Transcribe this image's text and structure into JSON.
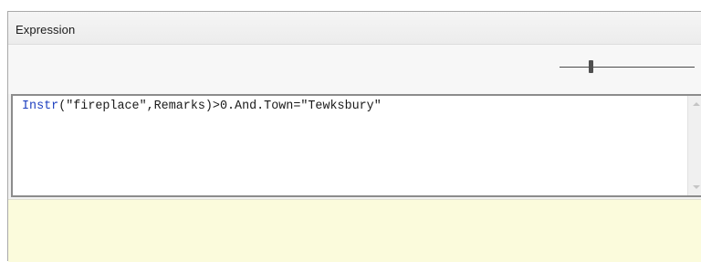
{
  "panel": {
    "title": "Expression"
  },
  "toolbar": {
    "zoom_slider": {
      "icon": "slider-icon",
      "level": 0.23
    }
  },
  "editor": {
    "function_name": "Instr",
    "expression_rest": "(\"fireplace\",Remarks)>0.And.Town=\"Tewksbury\"",
    "keyword_color": "#1d3fbf"
  },
  "result": {
    "background_color": "#fbfbdc",
    "text": ""
  }
}
